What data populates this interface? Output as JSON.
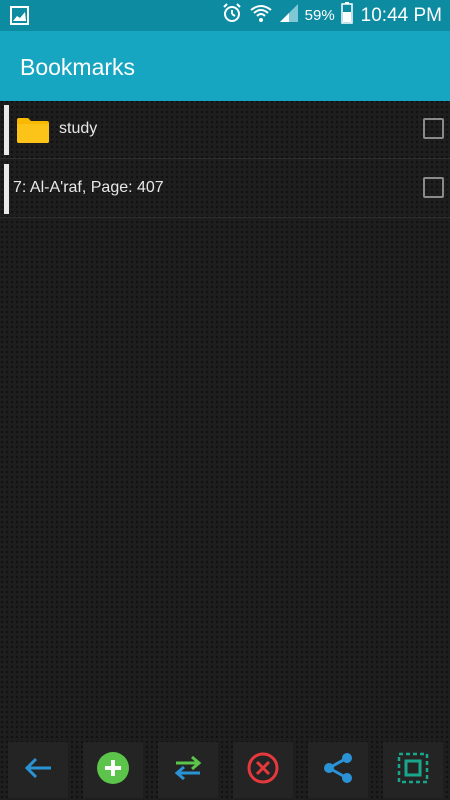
{
  "status_bar": {
    "battery_percent": "59%",
    "time": "10:44 PM",
    "icons": [
      "gallery-icon",
      "alarm-icon",
      "wifi-icon",
      "signal-icon",
      "battery-icon"
    ]
  },
  "app_bar": {
    "title": "Bookmarks"
  },
  "bookmarks": {
    "items": [
      {
        "type": "folder",
        "label": "study",
        "checked": false,
        "icon": "folder-icon"
      },
      {
        "type": "bookmark",
        "label": "7:  Al-A'raf, Page: 407",
        "checked": false
      }
    ]
  },
  "toolbar": {
    "buttons": [
      "back-icon",
      "add-icon",
      "swap-icon",
      "delete-icon",
      "share-icon",
      "select-all-icon"
    ]
  },
  "colors": {
    "status_bar": "#0d8ba0",
    "app_bar": "#17a6c1",
    "folder": "#f8b900",
    "add_green": "#5cc44a",
    "delete_red": "#e5393c",
    "accent_blue": "#2a93d6",
    "teal": "#1aa68b"
  }
}
